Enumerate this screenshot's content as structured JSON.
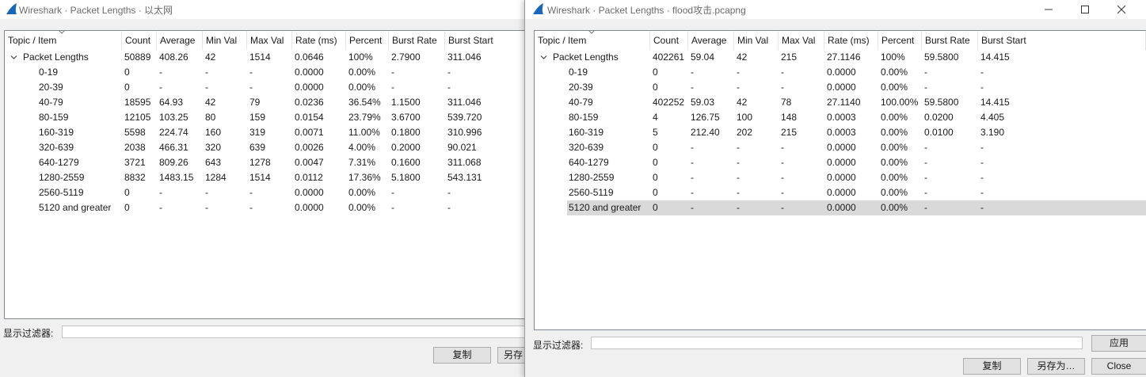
{
  "left_window": {
    "title": "Wireshark · Packet Lengths · 以太网",
    "columns": [
      "Topic / Item",
      "Count",
      "Average",
      "Min Val",
      "Max Val",
      "Rate (ms)",
      "Percent",
      "Burst Rate",
      "Burst Start"
    ],
    "rows": [
      {
        "item": "Packet Lengths",
        "count": "50889",
        "average": "408.26",
        "min": "42",
        "max": "1514",
        "rate": "0.0646",
        "percent": "100%",
        "burst_rate": "2.7900",
        "burst_start": "311.046"
      },
      {
        "item": "0-19",
        "count": "0",
        "average": "-",
        "min": "-",
        "max": "-",
        "rate": "0.0000",
        "percent": "0.00%",
        "burst_rate": "-",
        "burst_start": "-"
      },
      {
        "item": "20-39",
        "count": "0",
        "average": "-",
        "min": "-",
        "max": "-",
        "rate": "0.0000",
        "percent": "0.00%",
        "burst_rate": "-",
        "burst_start": "-"
      },
      {
        "item": "40-79",
        "count": "18595",
        "average": "64.93",
        "min": "42",
        "max": "79",
        "rate": "0.0236",
        "percent": "36.54%",
        "burst_rate": "1.1500",
        "burst_start": "311.046"
      },
      {
        "item": "80-159",
        "count": "12105",
        "average": "103.25",
        "min": "80",
        "max": "159",
        "rate": "0.0154",
        "percent": "23.79%",
        "burst_rate": "3.6700",
        "burst_start": "539.720"
      },
      {
        "item": "160-319",
        "count": "5598",
        "average": "224.74",
        "min": "160",
        "max": "319",
        "rate": "0.0071",
        "percent": "11.00%",
        "burst_rate": "0.1800",
        "burst_start": "310.996"
      },
      {
        "item": "320-639",
        "count": "2038",
        "average": "466.31",
        "min": "320",
        "max": "639",
        "rate": "0.0026",
        "percent": "4.00%",
        "burst_rate": "0.2000",
        "burst_start": "90.021"
      },
      {
        "item": "640-1279",
        "count": "3721",
        "average": "809.26",
        "min": "643",
        "max": "1278",
        "rate": "0.0047",
        "percent": "7.31%",
        "burst_rate": "0.1600",
        "burst_start": "311.068"
      },
      {
        "item": "1280-2559",
        "count": "8832",
        "average": "1483.15",
        "min": "1284",
        "max": "1514",
        "rate": "0.0112",
        "percent": "17.36%",
        "burst_rate": "5.1800",
        "burst_start": "543.131"
      },
      {
        "item": "2560-5119",
        "count": "0",
        "average": "-",
        "min": "-",
        "max": "-",
        "rate": "0.0000",
        "percent": "0.00%",
        "burst_rate": "-",
        "burst_start": "-"
      },
      {
        "item": "5120 and greater",
        "count": "0",
        "average": "-",
        "min": "-",
        "max": "-",
        "rate": "0.0000",
        "percent": "0.00%",
        "burst_rate": "-",
        "burst_start": "-"
      }
    ],
    "filter_label": "显示过滤器:",
    "filter_value": "",
    "copy_button": "复制",
    "save_as_button": "另存"
  },
  "right_window": {
    "title": "Wireshark · Packet Lengths · flood攻击.pcapng",
    "columns": [
      "Topic / Item",
      "Count",
      "Average",
      "Min Val",
      "Max Val",
      "Rate (ms)",
      "Percent",
      "Burst Rate",
      "Burst Start"
    ],
    "rows": [
      {
        "item": "Packet Lengths",
        "count": "402261",
        "average": "59.04",
        "min": "42",
        "max": "215",
        "rate": "27.1146",
        "percent": "100%",
        "burst_rate": "59.5800",
        "burst_start": "14.415"
      },
      {
        "item": "0-19",
        "count": "0",
        "average": "-",
        "min": "-",
        "max": "-",
        "rate": "0.0000",
        "percent": "0.00%",
        "burst_rate": "-",
        "burst_start": "-"
      },
      {
        "item": "20-39",
        "count": "0",
        "average": "-",
        "min": "-",
        "max": "-",
        "rate": "0.0000",
        "percent": "0.00%",
        "burst_rate": "-",
        "burst_start": "-"
      },
      {
        "item": "40-79",
        "count": "402252",
        "average": "59.03",
        "min": "42",
        "max": "78",
        "rate": "27.1140",
        "percent": "100.00%",
        "burst_rate": "59.5800",
        "burst_start": "14.415"
      },
      {
        "item": "80-159",
        "count": "4",
        "average": "126.75",
        "min": "100",
        "max": "148",
        "rate": "0.0003",
        "percent": "0.00%",
        "burst_rate": "0.0200",
        "burst_start": "4.405"
      },
      {
        "item": "160-319",
        "count": "5",
        "average": "212.40",
        "min": "202",
        "max": "215",
        "rate": "0.0003",
        "percent": "0.00%",
        "burst_rate": "0.0100",
        "burst_start": "3.190"
      },
      {
        "item": "320-639",
        "count": "0",
        "average": "-",
        "min": "-",
        "max": "-",
        "rate": "0.0000",
        "percent": "0.00%",
        "burst_rate": "-",
        "burst_start": "-"
      },
      {
        "item": "640-1279",
        "count": "0",
        "average": "-",
        "min": "-",
        "max": "-",
        "rate": "0.0000",
        "percent": "0.00%",
        "burst_rate": "-",
        "burst_start": "-"
      },
      {
        "item": "1280-2559",
        "count": "0",
        "average": "-",
        "min": "-",
        "max": "-",
        "rate": "0.0000",
        "percent": "0.00%",
        "burst_rate": "-",
        "burst_start": "-"
      },
      {
        "item": "2560-5119",
        "count": "0",
        "average": "-",
        "min": "-",
        "max": "-",
        "rate": "0.0000",
        "percent": "0.00%",
        "burst_rate": "-",
        "burst_start": "-"
      },
      {
        "item": "5120 and greater",
        "count": "0",
        "average": "-",
        "min": "-",
        "max": "-",
        "rate": "0.0000",
        "percent": "0.00%",
        "burst_rate": "-",
        "burst_start": "-"
      }
    ],
    "selected_row": "5120 and greater",
    "filter_label": "显示过滤器:",
    "filter_value": "",
    "apply_button": "应用",
    "copy_button": "复制",
    "save_as_button": "另存为…",
    "close_button": "Close"
  },
  "colors": {
    "selected_row": "#d9d9d9",
    "title_text": "#6b6b6b",
    "wireshark_fin": "#1667b7"
  },
  "icons": [
    "wireshark-fin-icon",
    "minimize-icon",
    "maximize-icon",
    "close-icon",
    "collapse-arrow-icon",
    "sort-caret-icon"
  ]
}
